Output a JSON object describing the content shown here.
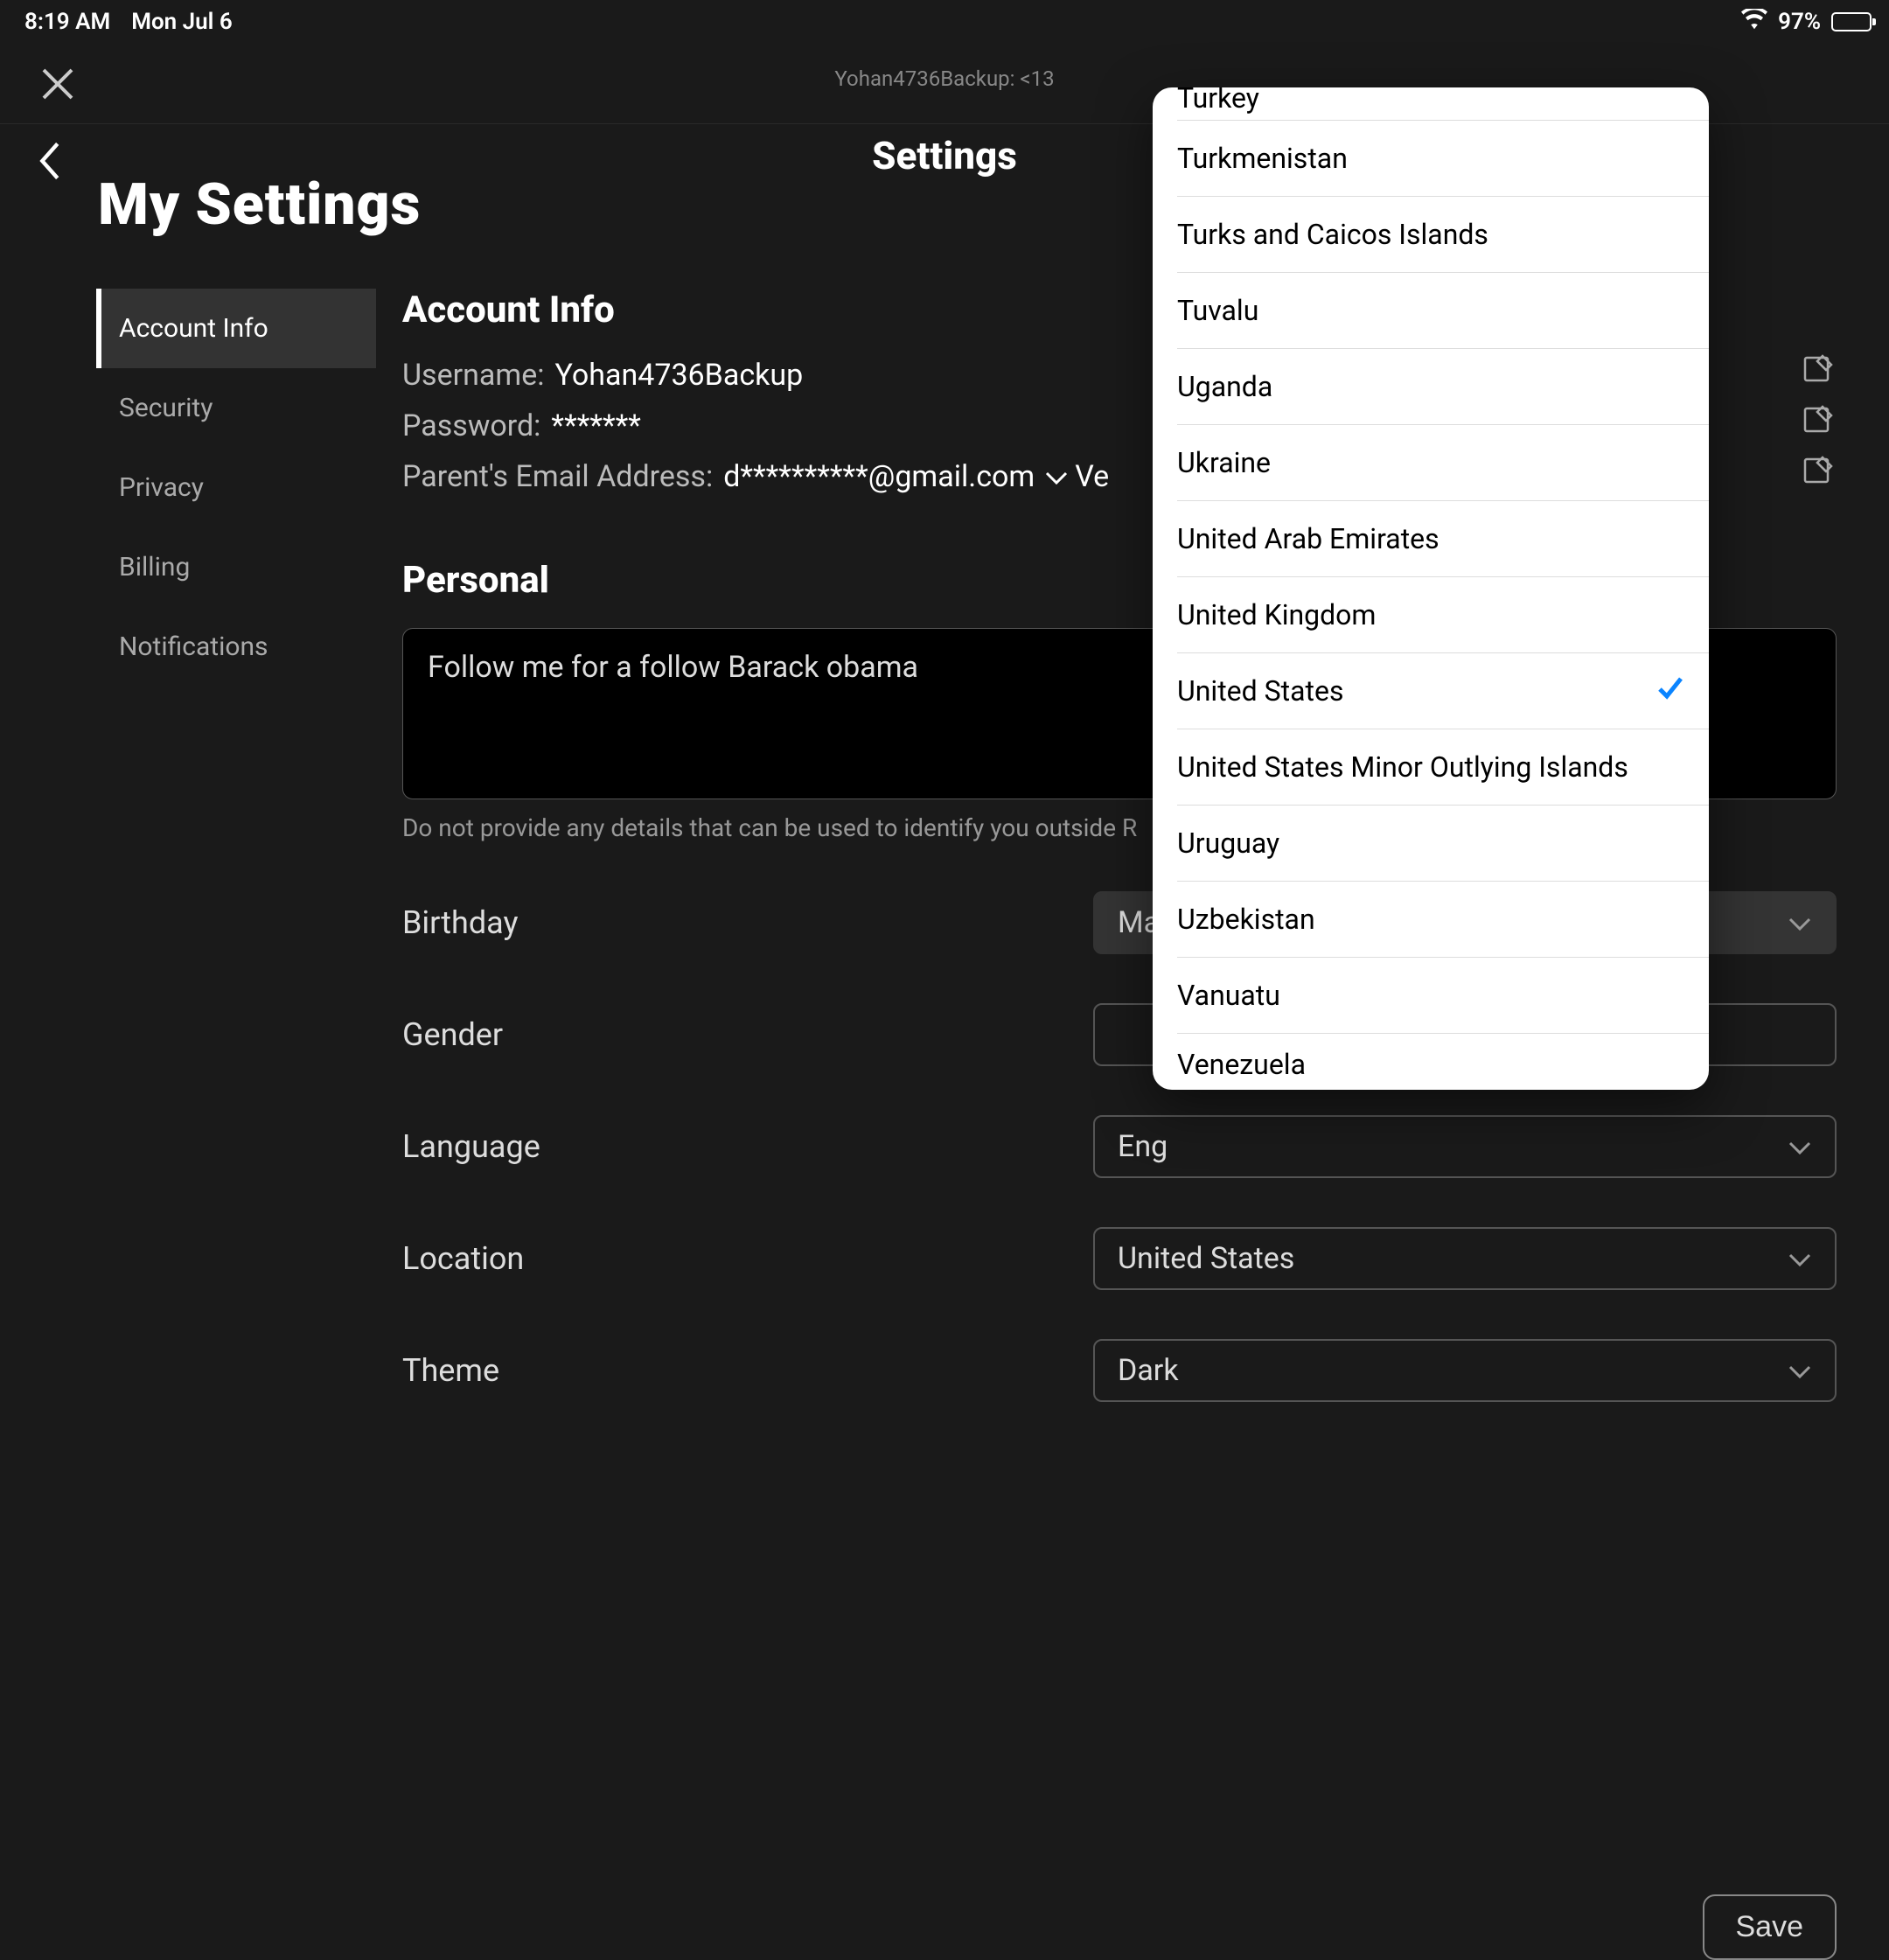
{
  "statusbar": {
    "time": "8:19 AM",
    "date": "Mon Jul 6",
    "battery_pct": "97%"
  },
  "window": {
    "title": "Yohan4736Backup: <13"
  },
  "page": {
    "center_title": "Settings",
    "big_heading": "My Settings"
  },
  "sidebar": {
    "items": [
      {
        "label": "Account Info"
      },
      {
        "label": "Security"
      },
      {
        "label": "Privacy"
      },
      {
        "label": "Billing"
      },
      {
        "label": "Notifications"
      }
    ]
  },
  "account_info": {
    "section_title": "Account Info",
    "username_label": "Username:",
    "username_value": "Yohan4736Backup",
    "password_label": "Password:",
    "password_value": "*******",
    "parent_email_label": "Parent's Email Address:",
    "parent_email_value": "d**********@gmail.com",
    "verified_partial": "Ve"
  },
  "personal": {
    "section_title": "Personal",
    "bio_value": "Follow me for a follow Barack obama",
    "bio_hint": "Do not provide any details that can be used to identify you outside R",
    "birthday_label": "Birthday",
    "birthday_value": "Mar",
    "gender_label": "Gender",
    "gender_value": "",
    "language_label": "Language",
    "language_value": "Eng",
    "location_label": "Location",
    "location_value": "United States",
    "theme_label": "Theme",
    "theme_value": "Dark"
  },
  "save_label": "Save",
  "popover": {
    "selected": "United States",
    "items": [
      "Turkey",
      "Turkmenistan",
      "Turks and Caicos Islands",
      "Tuvalu",
      "Uganda",
      "Ukraine",
      "United Arab Emirates",
      "United Kingdom",
      "United States",
      "United States Minor Outlying Islands",
      "Uruguay",
      "Uzbekistan",
      "Vanuatu",
      "Venezuela"
    ]
  }
}
